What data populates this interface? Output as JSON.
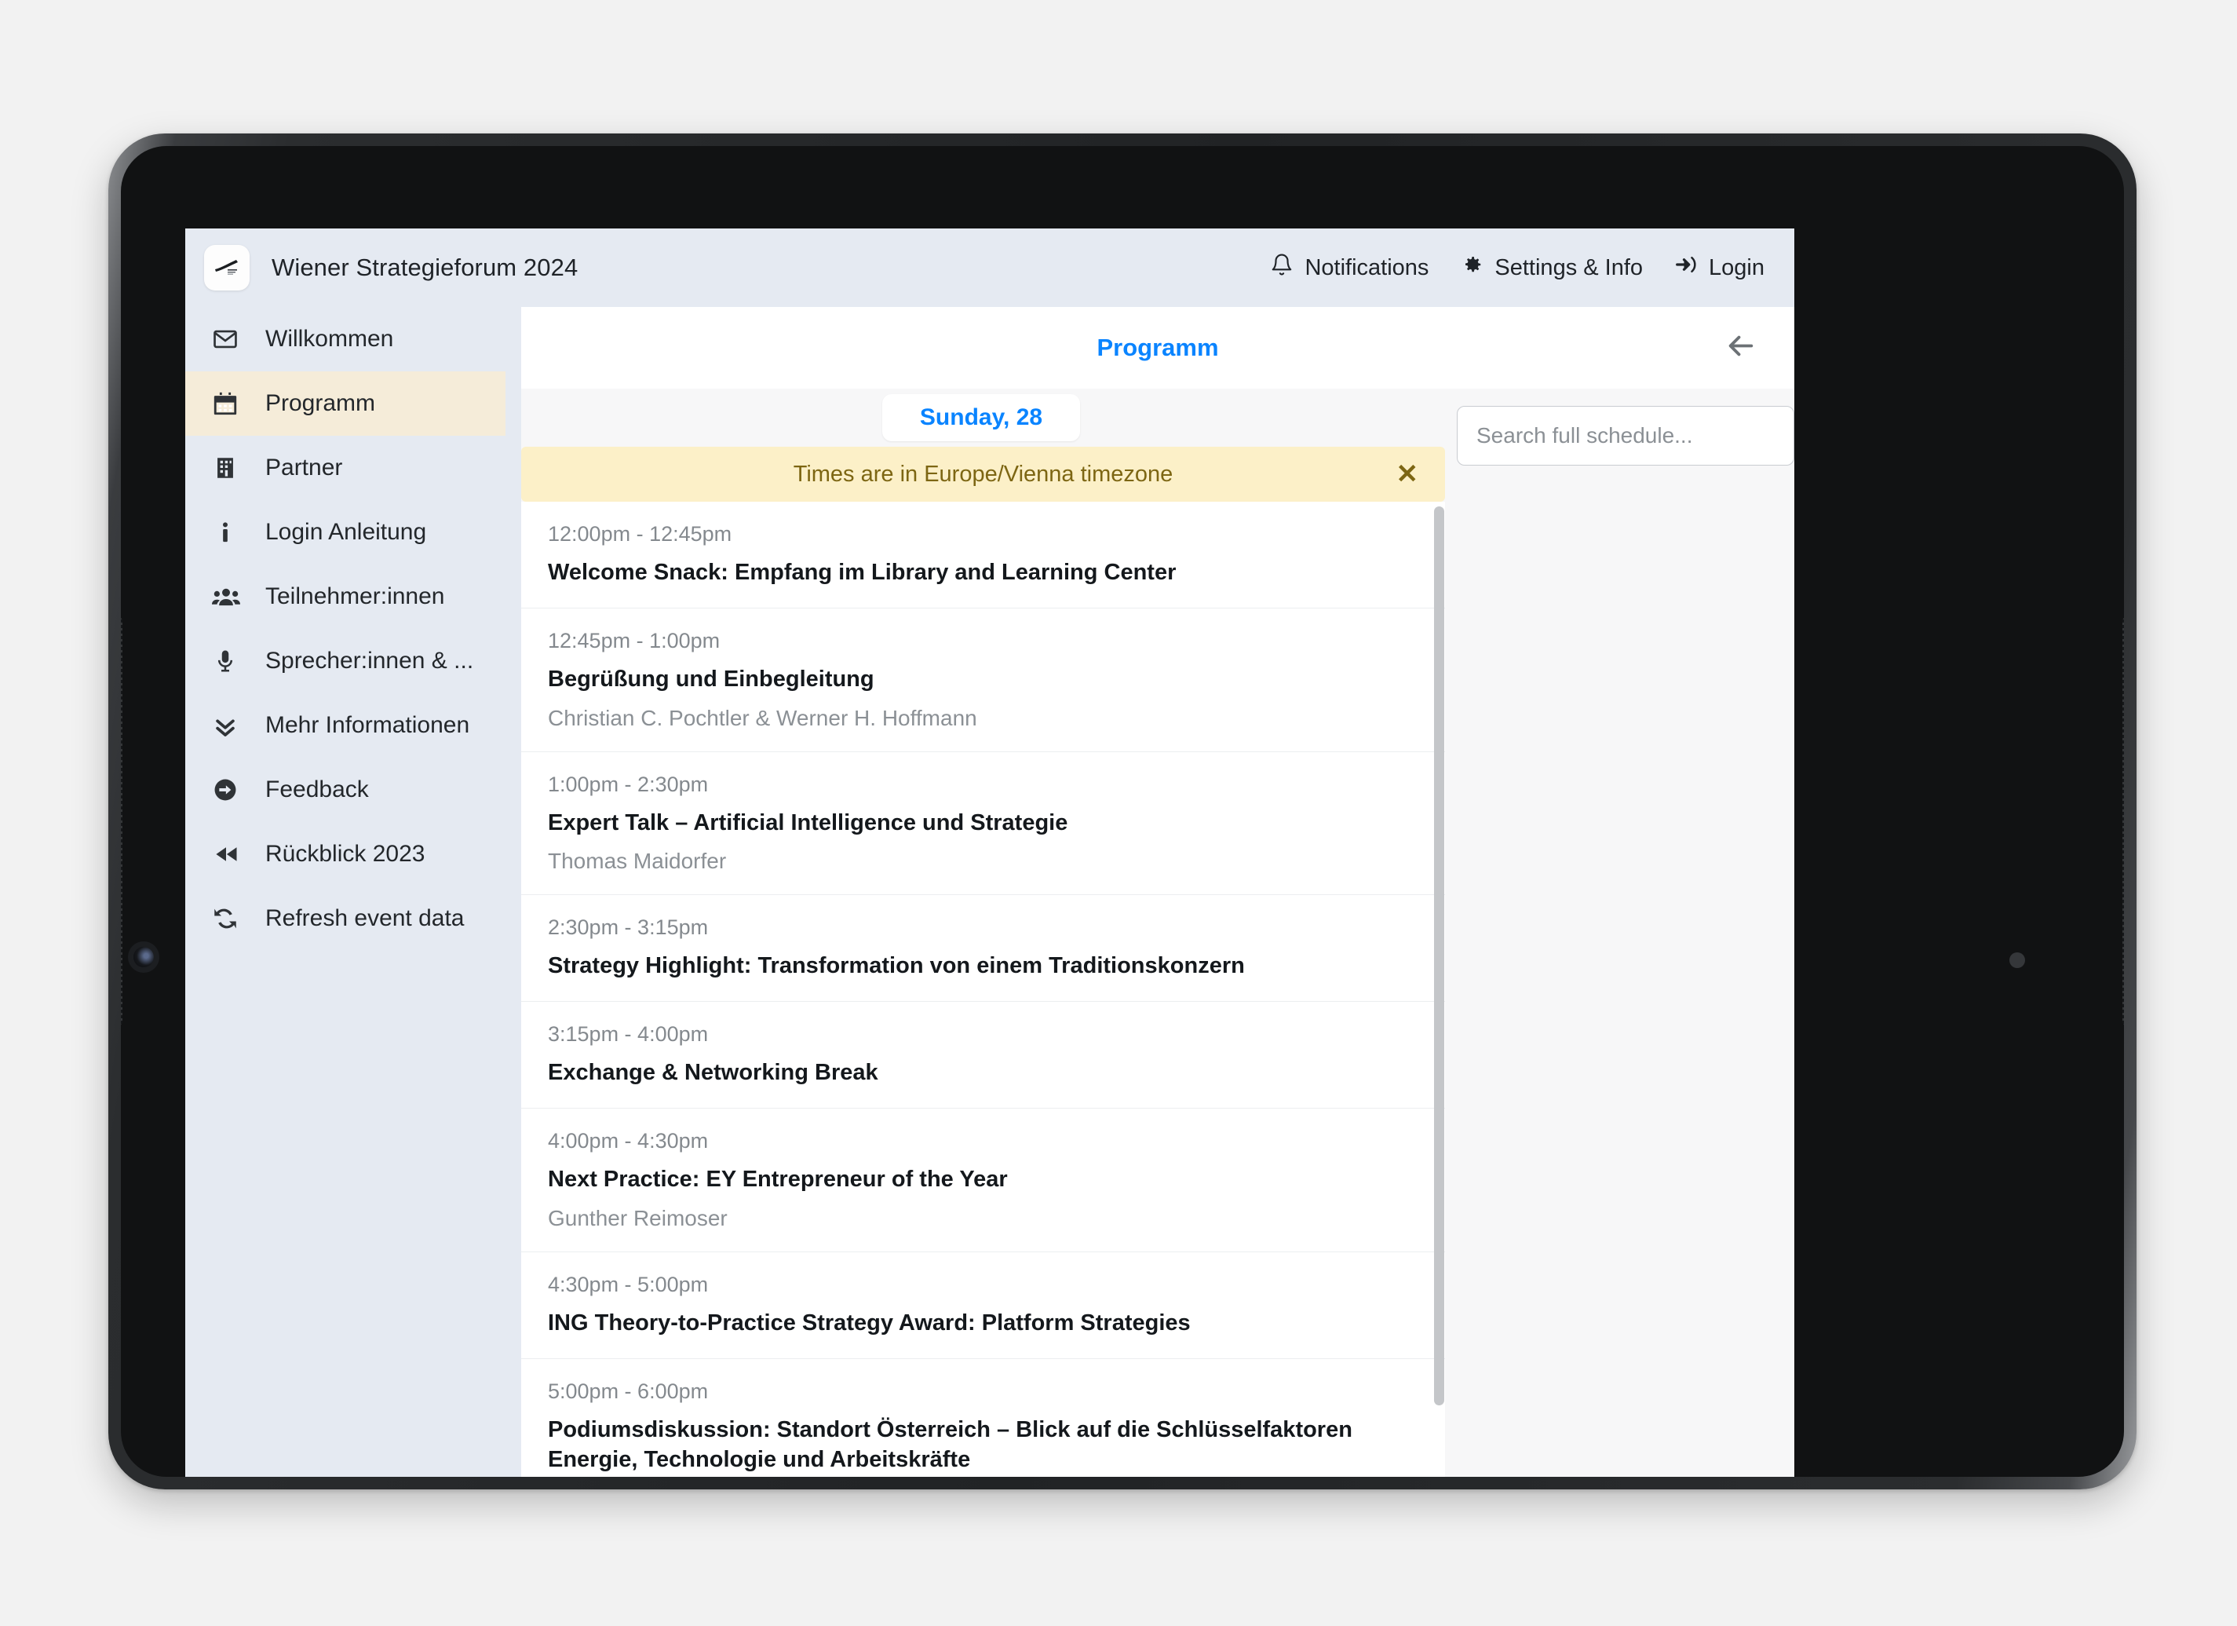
{
  "app": {
    "title": "Wiener Strategieforum 2024",
    "logo_icon": "swoosh-logo-icon"
  },
  "top_bar": {
    "actions": [
      {
        "label": "Notifications",
        "icon": "bell-icon"
      },
      {
        "label": "Settings & Info",
        "icon": "gear-icon"
      },
      {
        "label": "Login",
        "icon": "login-arrow-icon"
      }
    ]
  },
  "sidebar": {
    "items": [
      {
        "label": "Willkommen",
        "icon": "envelope-icon",
        "active": false
      },
      {
        "label": "Programm",
        "icon": "calendar-icon",
        "active": true
      },
      {
        "label": "Partner",
        "icon": "building-icon",
        "active": false
      },
      {
        "label": "Login Anleitung",
        "icon": "info-icon",
        "active": false
      },
      {
        "label": "Teilnehmer:innen",
        "icon": "users-icon",
        "active": false
      },
      {
        "label": "Sprecher:innen & ...",
        "icon": "microphone-icon",
        "active": false
      },
      {
        "label": "Mehr Informationen",
        "icon": "double-chevron-down-icon",
        "active": false
      },
      {
        "label": "Feedback",
        "icon": "arrow-circle-right-icon",
        "active": false
      },
      {
        "label": "Rückblick 2023",
        "icon": "rewind-icon",
        "active": false
      },
      {
        "label": "Refresh event data",
        "icon": "refresh-icon",
        "active": false
      }
    ]
  },
  "content": {
    "header_title": "Programm",
    "back_icon": "back-arrow-icon",
    "day_tab": "Sunday, 28",
    "search": {
      "value": "",
      "placeholder": "Search full schedule..."
    },
    "timezone_banner": {
      "text": "Times are in Europe/Vienna timezone",
      "close_icon": "close-icon"
    },
    "sessions": [
      {
        "time": "12:00pm - 12:45pm",
        "title": "Welcome Snack: Empfang im Library and Learning Center",
        "speaker": ""
      },
      {
        "time": "12:45pm - 1:00pm",
        "title": "Begrüßung und Einbegleitung",
        "speaker": "Christian C. Pochtler & Werner H. Hoffmann"
      },
      {
        "time": "1:00pm - 2:30pm",
        "title": "Expert Talk – Artificial Intelligence und Strategie",
        "speaker": "Thomas Maidorfer"
      },
      {
        "time": "2:30pm - 3:15pm",
        "title": "Strategy Highlight: Transformation von einem Traditionskonzern",
        "speaker": ""
      },
      {
        "time": "3:15pm - 4:00pm",
        "title": "Exchange & Networking Break",
        "speaker": ""
      },
      {
        "time": "4:00pm - 4:30pm",
        "title": "Next Practice: EY Entrepreneur of the Year",
        "speaker": "Gunther Reimoser"
      },
      {
        "time": "4:30pm - 5:00pm",
        "title": "ING Theory-to-Practice Strategy Award: Platform Strategies",
        "speaker": ""
      },
      {
        "time": "5:00pm - 6:00pm",
        "title": "Podiumsdiskussion: Standort Österreich – Blick auf die Schlüsselfaktoren Energie, Technologie und Arbeitskräfte",
        "speaker": ""
      }
    ]
  },
  "colors": {
    "accent_blue": "#0a84ff",
    "sidebar_bg": "#e5eaf2",
    "active_item_bg": "#f5ecd9",
    "banner_bg": "#fcf0c8",
    "banner_text": "#7d6613"
  }
}
